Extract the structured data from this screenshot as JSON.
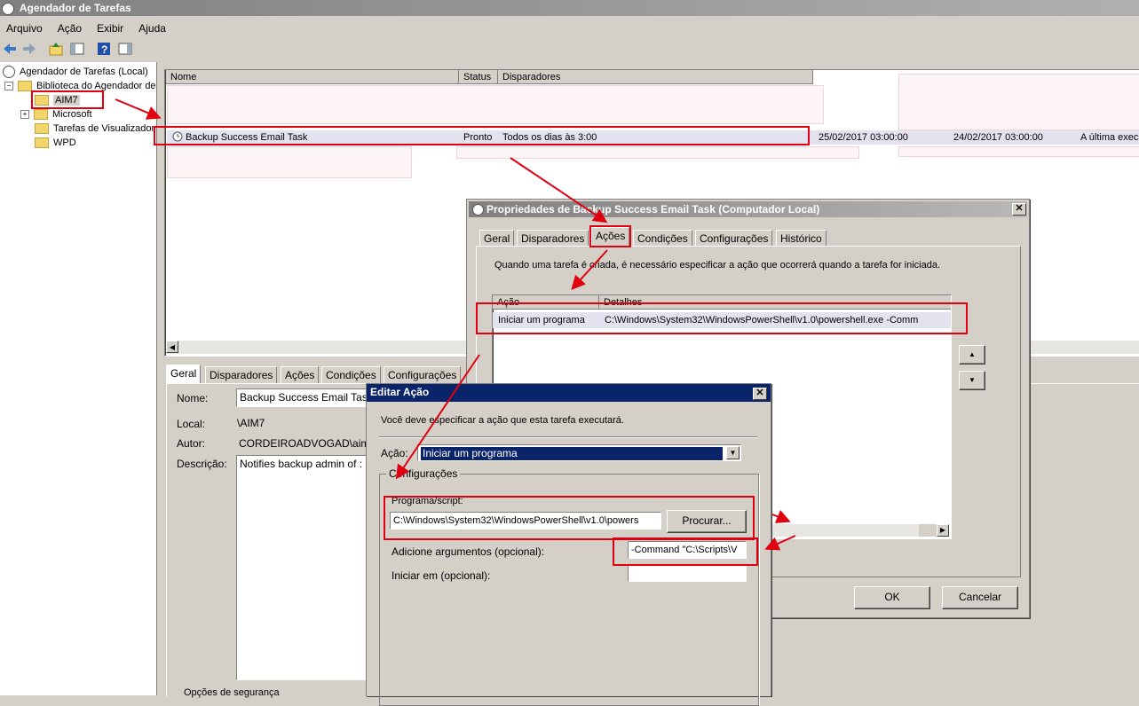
{
  "app": {
    "title": "Agendador de Tarefas"
  },
  "menu": [
    "Arquivo",
    "Ação",
    "Exibir",
    "Ajuda"
  ],
  "tree": {
    "root": "Agendador de Tarefas (Local)",
    "library": "Biblioteca do Agendador de",
    "items": [
      "AIM7",
      "Microsoft",
      "Tarefas de Visualizador",
      "WPD"
    ]
  },
  "task_list": {
    "columns": [
      "Nome",
      "Status",
      "Disparadores"
    ],
    "row": {
      "name": "Backup Success Email Task",
      "status": "Pronto",
      "trigger": "Todos os dias às 3:00",
      "next_run": "25/02/2017 03:00:00",
      "last_run": "24/02/2017 03:00:00",
      "result": "A última exec"
    }
  },
  "detail_pane": {
    "tabs": [
      "Geral",
      "Disparadores",
      "Ações",
      "Condições",
      "Configurações"
    ],
    "name_label": "Nome:",
    "name_value": "Backup Success Email Task",
    "location_label": "Local:",
    "location_value": "\\AIM7",
    "author_label": "Autor:",
    "author_value": "CORDEIROADVOGAD\\aim7",
    "description_label": "Descrição:",
    "description_value": "Notifies backup admin of :",
    "security_label": "Opções de segurança"
  },
  "props_dialog": {
    "title": "Propriedades de Backup Success Email Task (Computador Local)",
    "tabs": [
      "Geral",
      "Disparadores",
      "Ações",
      "Condições",
      "Configurações",
      "Histórico"
    ],
    "info": "Quando uma tarefa é criada, é necessário especificar a ação que ocorrerá quando a tarefa for iniciada.",
    "columns": [
      "Ação",
      "Detalhes"
    ],
    "action": "Iniciar um programa",
    "details": "C:\\Windows\\System32\\WindowsPowerShell\\v1.0\\powershell.exe -Comm",
    "up": "▲",
    "down": "▼",
    "ok": "OK",
    "cancel": "Cancelar"
  },
  "edit_dialog": {
    "title": "Editar Ação",
    "info": "Você deve especificar a ação que esta tarefa executará.",
    "action_label": "Ação:",
    "action_value": "Iniciar um programa",
    "settings_label": "Configurações",
    "program_label": "Programa/script:",
    "program_value": "C:\\Windows\\System32\\WindowsPowerShell\\v1.0\\powers",
    "browse": "Procurar...",
    "args_label": "Adicione argumentos (opcional):",
    "args_value": "-Command \"C:\\Scripts\\V",
    "start_label": "Iniciar em (opcional):",
    "start_value": ""
  },
  "colors": {
    "highlight": "#e00010",
    "selection": "#0a246a",
    "title_active": "#0a246a"
  }
}
